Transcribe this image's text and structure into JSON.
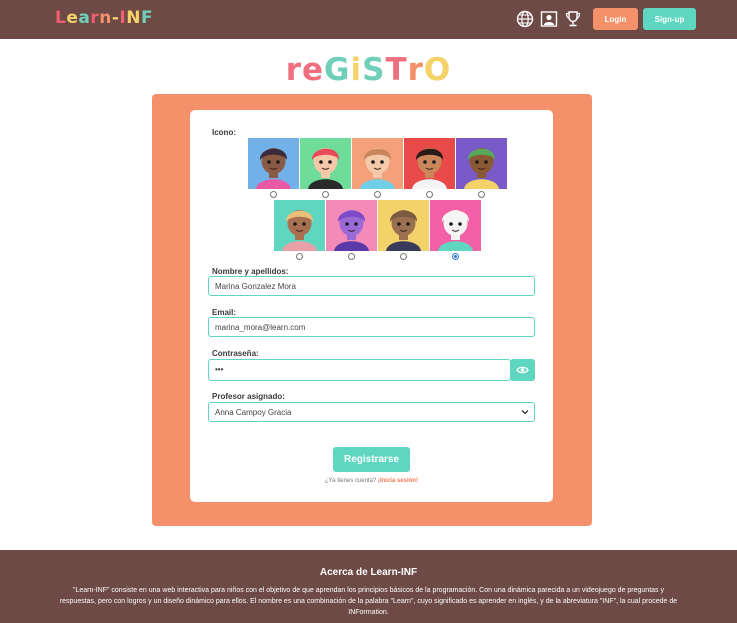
{
  "header": {
    "logo": [
      "L",
      "e",
      "a",
      "r",
      "n",
      "-",
      "I",
      "N",
      "F"
    ],
    "logo_colors": [
      "#ef5f6f",
      "#f4d26a",
      "#6fcfb8",
      "#ef5f6f",
      "#f4906a",
      "#f4d26a",
      "#ef5f6f",
      "#f4d26a",
      "#6fcfb8"
    ],
    "icons": [
      "globe-icon",
      "profile-icon",
      "trophy-icon"
    ],
    "login_label": "Login",
    "signup_label": "Sign-up"
  },
  "title": {
    "letters": [
      "r",
      "e",
      "G",
      "i",
      "S",
      "T",
      "r",
      "O"
    ],
    "colors": [
      "#ef6f7f",
      "#ef6f7f",
      "#6fcfb8",
      "#f4d26a",
      "#6fcfb8",
      "#ef6f7f",
      "#f4906a",
      "#f4d26a"
    ]
  },
  "form": {
    "icon_label": "Icono:",
    "avatars": [
      {
        "bg": "#72b0e8",
        "hair": "#3a2a3a",
        "skin": "#8a5a45",
        "shirt": "#e85aa8",
        "selected": false
      },
      {
        "bg": "#6fdc9a",
        "hair": "#e84a5a",
        "skin": "#f4c8a8",
        "shirt": "#2a2a2a",
        "selected": false
      },
      {
        "bg": "#f4a07a",
        "hair": "#c8865a",
        "skin": "#f4c8a8",
        "shirt": "#6fcfe8",
        "selected": false
      },
      {
        "bg": "#e84a4a",
        "hair": "#2a1a1a",
        "skin": "#c8865a",
        "shirt": "#f4f4f4",
        "selected": false
      },
      {
        "bg": "#7a5ac8",
        "hair": "#5aa85a",
        "skin": "#8a5a35",
        "shirt": "#f4d26a",
        "selected": false
      },
      {
        "bg": "#5fd6bf",
        "hair": "#e8c07a",
        "skin": "#a87050",
        "shirt": "#e8a0a8",
        "selected": false
      },
      {
        "bg": "#f48ab8",
        "hair": "#7a4ac8",
        "skin": "#9a6ad8",
        "shirt": "#5a3aa8",
        "selected": false
      },
      {
        "bg": "#f4d26a",
        "hair": "#7a5a40",
        "skin": "#9a7050",
        "shirt": "#3a3a5a",
        "selected": false
      },
      {
        "bg": "#f460a8",
        "hair": "#f4f4f4",
        "skin": "#f4f4f4",
        "shirt": "#5fd6bf",
        "selected": true
      }
    ],
    "name_label": "Nombre y apellidos:",
    "name_value": "Marina Gonzalez Mora",
    "email_label": "Email:",
    "email_value": "marina_mora@learn.com",
    "password_label": "Contraseña:",
    "password_value": "•••",
    "teacher_label": "Profesor asignado:",
    "teacher_value": "Anna Campoy Gracia",
    "register_label": "Registrarse",
    "have_account": "¿Ya tienes cuenta?",
    "login_link": "¡Inicia sesión!"
  },
  "footer": {
    "title": "Acerca de Learn-INF",
    "text": "\"Learn-INF\" consiste en una web interactiva para niños con el objetivo de que aprendan los principios básicos de la programación. Con una dinámica parecida a un videojuego de preguntas y respuestas, pero con logros y un diseño dinámico para ellos. El nombre es una combinación de la palabra \"Learn\", cuyo significado es aprender en inglés, y de la abreviatura \"INF\", la cual procede de INFormation."
  }
}
